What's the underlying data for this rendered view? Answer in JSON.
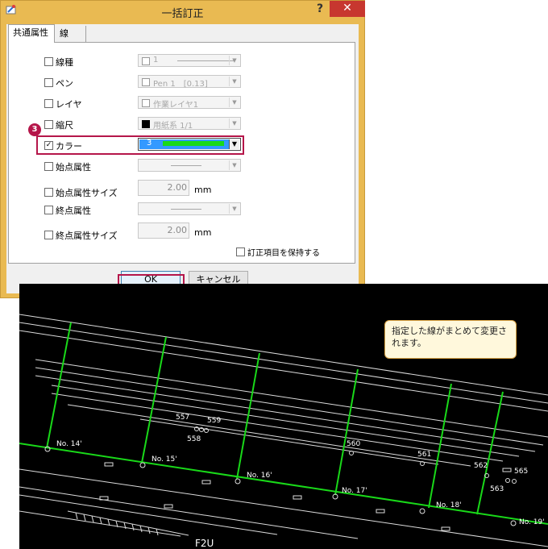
{
  "dialog": {
    "title": "一括訂正",
    "help_label": "?",
    "close_label": "✕",
    "tabs": [
      {
        "label": "共通属性"
      },
      {
        "label": "線"
      }
    ],
    "rows": [
      {
        "label": "線種",
        "checked": false,
        "value": "1"
      },
      {
        "label": "ペン",
        "checked": false,
        "value": "Pen 1　[0.13]"
      },
      {
        "label": "レイヤ",
        "checked": false,
        "value": "作業レイヤ1"
      },
      {
        "label": "縮尺",
        "checked": false,
        "value": "用紙系 1/1"
      },
      {
        "label": "カラー",
        "checked": true,
        "value": "3"
      },
      {
        "label": "始点属性",
        "checked": false,
        "value": ""
      },
      {
        "label": "始点属性サイズ",
        "checked": false,
        "value": "2.00",
        "unit": "mm"
      },
      {
        "label": "終点属性",
        "checked": false,
        "value": ""
      },
      {
        "label": "終点属性サイズ",
        "checked": false,
        "value": "2.00",
        "unit": "mm"
      }
    ],
    "keep_label": "訂正項目を保持する",
    "ok_label": "OK",
    "cancel_label": "キャンセル",
    "step_badge": "3",
    "check_mark": "✓"
  },
  "cad": {
    "note": "指定した線がまとめて変更されます。",
    "station_labels": [
      "No. 14'",
      "No. 15'",
      "No. 16'",
      "No. 17'",
      "No. 18'",
      "No. 19'"
    ],
    "point_labels": [
      "557",
      "559",
      "558",
      "560",
      "561",
      "562",
      "565",
      "563"
    ],
    "bottom_text": "F2U",
    "highlight_color": "#19d919",
    "line_color": "#e8e8e8"
  },
  "colors": {
    "accent": "#b5164a",
    "title_bar": "#e9ba52",
    "arrow": "#e05a1e",
    "selection": "#3399ff"
  }
}
